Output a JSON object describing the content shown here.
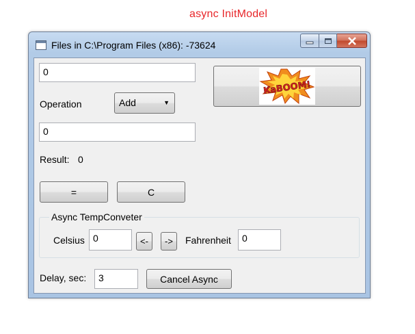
{
  "annotation": {
    "text": "async InitModel",
    "color": "#e8262a"
  },
  "window": {
    "title": "Files in C:\\Program Files (x86): -73624",
    "icon": "app-window-icon",
    "controls": {
      "minimize": "minimize-icon",
      "maximize": "maximize-icon",
      "close": "close-icon"
    }
  },
  "calculator": {
    "operand1": "0",
    "operation_label": "Operation",
    "operation_selected": "Add",
    "operand2": "0",
    "result_label": "Result:",
    "result_value": "0",
    "equals_label": "=",
    "clear_label": "C",
    "kaboom_image_text": "KaBOOM!"
  },
  "temp_converter": {
    "group_title": "Async TempConveter",
    "celsius_label": "Celsius",
    "celsius_value": "0",
    "to_celsius_label": "<-",
    "to_fahrenheit_label": "->",
    "fahrenheit_label": "Fahrenheit",
    "fahrenheit_value": "0"
  },
  "delay": {
    "label": "Delay, sec:",
    "value": "3",
    "cancel_label": "Cancel Async"
  }
}
